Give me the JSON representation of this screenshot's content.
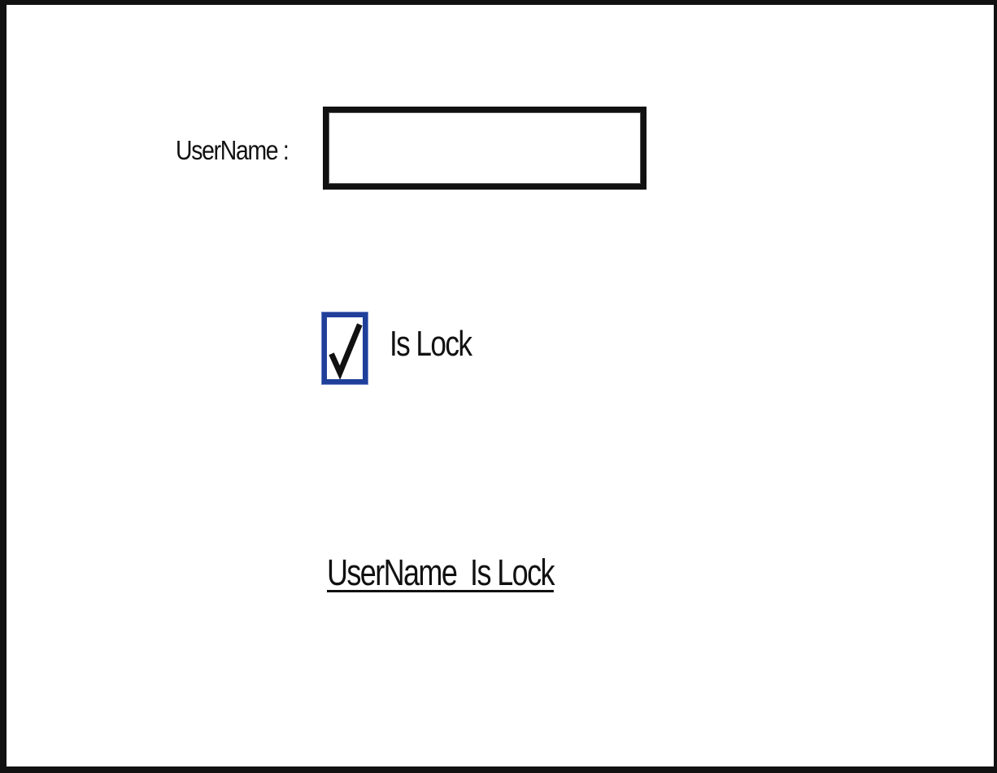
{
  "form": {
    "username_label": "UserName :",
    "username_value": "",
    "username_placeholder": "",
    "lock_checkbox_label": "Is Lock",
    "lock_checked": true,
    "status_link_text": "UserName  Is Lock"
  },
  "colors": {
    "checkbox_border": "#1f3f9a",
    "text": "#111111",
    "frame_border": "#111111"
  },
  "icons": {
    "checkbox": "check-mark-icon"
  }
}
